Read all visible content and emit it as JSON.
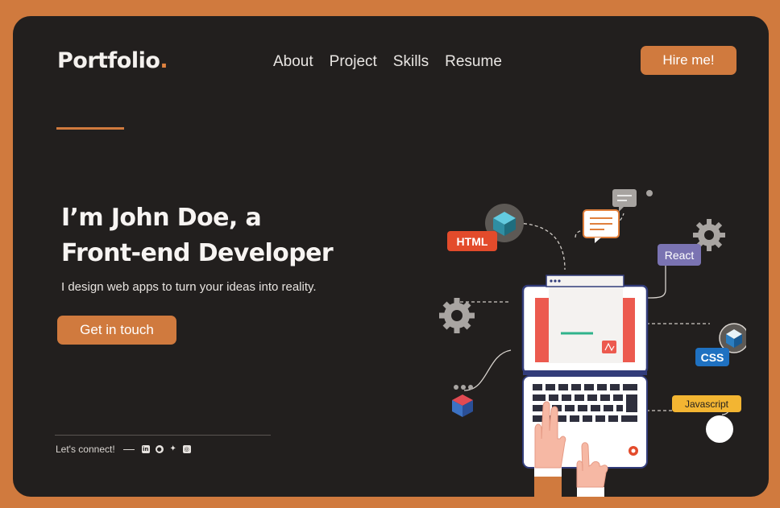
{
  "brand": {
    "name": "Portfolio",
    "dot": "."
  },
  "nav": {
    "items": [
      "About",
      "Project",
      "Skills",
      "Resume"
    ]
  },
  "header": {
    "hire_label": "Hire me!"
  },
  "hero": {
    "headline_line1": "I’m John Doe, a",
    "headline_line2": "Front-end Developer",
    "tagline": "I design web apps to turn your ideas into reality.",
    "cta_label": "Get in touch"
  },
  "footer": {
    "connect_label": "Let's connect!",
    "social_icons": [
      "linkedin-icon",
      "github-icon",
      "twitter-icon",
      "instagram-icon"
    ]
  },
  "illustration": {
    "tags": {
      "html": "HTML",
      "react": "React",
      "css": "CSS",
      "javascript": "Javascript"
    }
  },
  "colors": {
    "background": "#d07a3e",
    "panel": "#221f1e",
    "accent": "#d07a3e",
    "text": "#f4f1ee"
  }
}
